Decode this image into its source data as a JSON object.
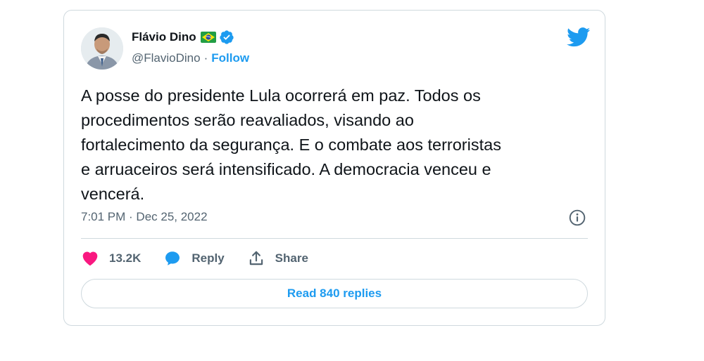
{
  "author": {
    "display_name": "Flávio Dino",
    "handle": "@FlavioDino",
    "separator": "·",
    "follow_label": "Follow",
    "flag_icon": "brazil-flag-icon",
    "verified_icon": "verified-badge-icon"
  },
  "tweet": {
    "text": "A posse do presidente Lula ocorrerá em paz. Todos os\nprocedimentos serão reavaliados, visando ao\nfortalecimento da segurança. E o combate aos terroristas\ne arruaceiros será intensificado. A democracia venceu e\nvencerá.",
    "timestamp": "7:01 PM · Dec 25, 2022"
  },
  "actions": {
    "like_count": "13.2K",
    "reply_label": "Reply",
    "share_label": "Share"
  },
  "read_replies_label": "Read 840 replies",
  "colors": {
    "accent": "#1d9bf0",
    "like": "#f91880",
    "text": "#0f1419",
    "secondary": "#536471",
    "border": "#cfd9de"
  }
}
